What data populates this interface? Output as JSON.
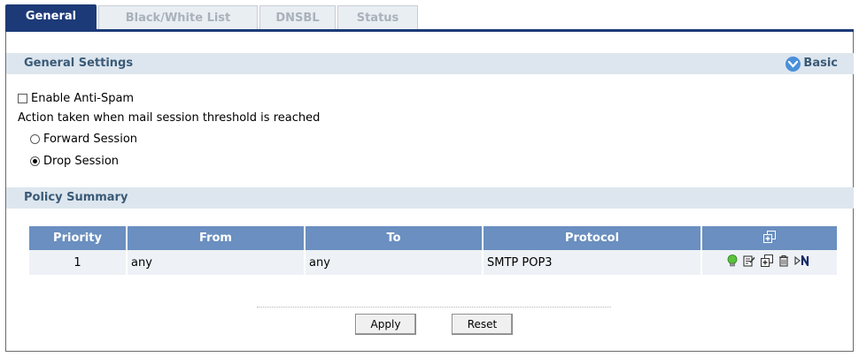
{
  "tabs": [
    {
      "label": "General",
      "active": true
    },
    {
      "label": "Black/White List",
      "active": false
    },
    {
      "label": "DNSBL",
      "active": false
    },
    {
      "label": "Status",
      "active": false
    }
  ],
  "general_settings": {
    "title": "General Settings",
    "basic_label": "Basic",
    "enable_antispam_label": "Enable Anti-Spam",
    "enable_antispam_checked": false,
    "action_text": "Action taken when mail session threshold is reached",
    "options": [
      {
        "label": "Forward Session",
        "selected": false
      },
      {
        "label": "Drop Session",
        "selected": true
      }
    ]
  },
  "policy_summary": {
    "title": "Policy Summary",
    "columns": [
      "Priority",
      "From",
      "To",
      "Protocol"
    ],
    "rows": [
      {
        "priority": "1",
        "from": "any",
        "to": "any",
        "protocol": "SMTP POP3"
      }
    ]
  },
  "buttons": {
    "apply": "Apply",
    "reset": "Reset"
  },
  "colors": {
    "active_tab": "#1c3a78",
    "section_bg": "#dde6ee",
    "table_header": "#6a8fc0"
  }
}
